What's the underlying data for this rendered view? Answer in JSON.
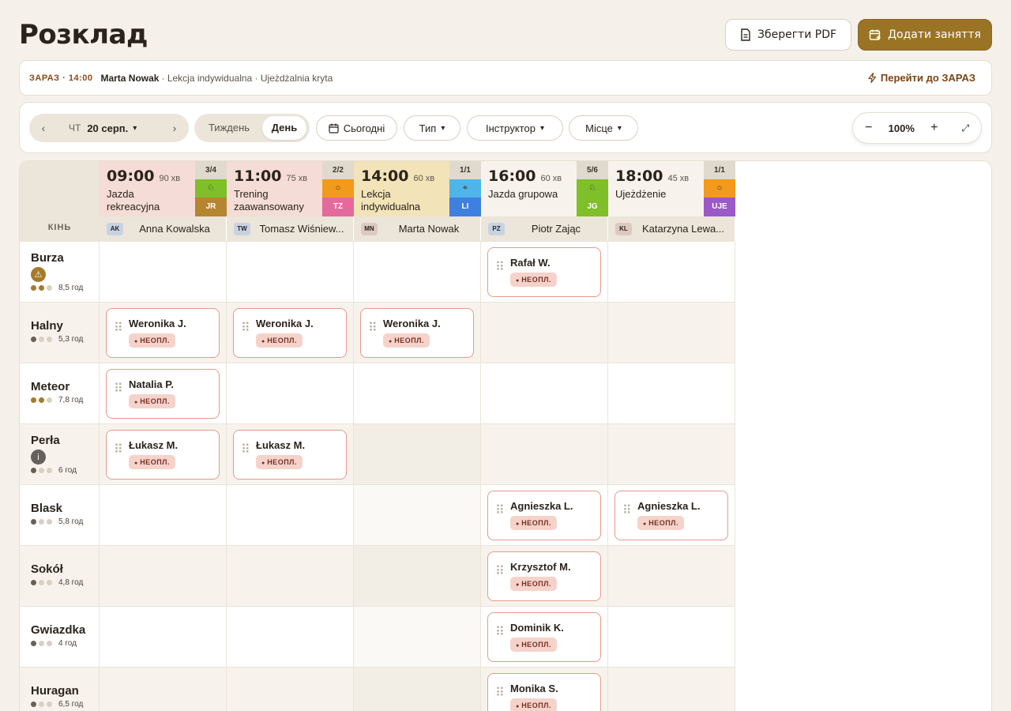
{
  "page": {
    "title": "Розклад"
  },
  "actions": {
    "pdf_label": "Зберегти PDF",
    "add_label": "Додати заняття"
  },
  "now": {
    "tag": "ЗАРАЗ · 14:00",
    "person": "Marta Nowak",
    "desc": "· Lekcja indywidualna · Ujeżdżalnia kryta",
    "link": "Перейти до ЗАРАЗ"
  },
  "toolbar": {
    "dow": "ЧТ",
    "date": "20 серп.",
    "week": "Тиждень",
    "day": "День",
    "today": "Сьогодні",
    "type": "Тип",
    "instructor": "Інструктор",
    "place": "Місце",
    "zoom": "100%"
  },
  "grid": {
    "corner": "КІНЬ"
  },
  "sessions": [
    {
      "time": "09:00",
      "dur": "90 хв",
      "name": "Jazda rekreacyjna",
      "count": "3/4",
      "code": "JR",
      "bg": "#f5dcd6",
      "icon_bg": "#7fbf2a",
      "code_bg": "#b5852f",
      "icon": "horse-icon"
    },
    {
      "time": "11:00",
      "dur": "75 хв",
      "name": "Trening zaawansowany",
      "count": "2/2",
      "code": "TZ",
      "bg": "#f5dcd6",
      "icon_bg": "#f29a1d",
      "code_bg": "#e36b9b",
      "icon": "circle-icon"
    },
    {
      "time": "14:00",
      "dur": "60 хв",
      "name": "Lekcja indywidualna",
      "count": "1/1",
      "code": "LI",
      "bg": "#f3e3b8",
      "icon_bg": "#4fb4e8",
      "code_bg": "#3e7fe0",
      "icon": "pin-icon"
    },
    {
      "time": "16:00",
      "dur": "60 хв",
      "name": "Jazda grupowa",
      "count": "5/6",
      "code": "JG",
      "bg": "#f7f3ec",
      "icon_bg": "#7fbf2a",
      "code_bg": "#7fbf2a",
      "icon": "horse-icon"
    },
    {
      "time": "18:00",
      "dur": "45 хв",
      "name": "Ujeżdżenie",
      "count": "1/1",
      "code": "UJE",
      "bg": "#f7f3ec",
      "icon_bg": "#f29a1d",
      "code_bg": "#9b59c8",
      "icon": "circle-icon"
    }
  ],
  "instructors": [
    {
      "ini": "AK",
      "name": "Anna Kowalska",
      "ini_bg": "#c7d3e3"
    },
    {
      "ini": "TW",
      "name": "Tomasz Wiśniew...",
      "ini_bg": "#c7d3e3"
    },
    {
      "ini": "MN",
      "name": "Marta Nowak",
      "ini_bg": "#ddc9bf"
    },
    {
      "ini": "PZ",
      "name": "Piotr Zając",
      "ini_bg": "#c7d3e3"
    },
    {
      "ini": "KL",
      "name": "Katarzyna Lewa...",
      "ini_bg": "#ddc9bf"
    }
  ],
  "unpaid_label": "НЕОПЛ.",
  "horses": [
    {
      "name": "Burza",
      "level": 2,
      "dark": false,
      "hours": "8,5 год",
      "badge": "warn",
      "cells": [
        "",
        "",
        "",
        "Rafał W.",
        ""
      ]
    },
    {
      "name": "Halny",
      "level": 1,
      "dark": true,
      "hours": "5,3 год",
      "badge": "",
      "cells": [
        "Weronika J.",
        "Weronika J.",
        "Weronika J.",
        "",
        ""
      ]
    },
    {
      "name": "Meteor",
      "level": 2,
      "dark": false,
      "hours": "7,8 год",
      "badge": "",
      "cells": [
        "Natalia P.",
        "",
        "",
        "",
        ""
      ]
    },
    {
      "name": "Perła",
      "level": 1,
      "dark": true,
      "hours": "6 год",
      "badge": "info",
      "cells": [
        "Łukasz M.",
        "Łukasz M.",
        "",
        "",
        ""
      ]
    },
    {
      "name": "Blask",
      "level": 1,
      "dark": true,
      "hours": "5,8 год",
      "badge": "",
      "cells": [
        "",
        "",
        "",
        "Agnieszka L.",
        "Agnieszka L."
      ]
    },
    {
      "name": "Sokół",
      "level": 1,
      "dark": true,
      "hours": "4,8 год",
      "badge": "",
      "cells": [
        "",
        "",
        "",
        "Krzysztof M.",
        ""
      ]
    },
    {
      "name": "Gwiazdka",
      "level": 1,
      "dark": true,
      "hours": "4 год",
      "badge": "",
      "cells": [
        "",
        "",
        "",
        "Dominik K.",
        ""
      ]
    },
    {
      "name": "Huragan",
      "level": 1,
      "dark": true,
      "hours": "6,5 год",
      "badge": "",
      "cells": [
        "",
        "",
        "",
        "Monika S.",
        ""
      ]
    }
  ]
}
